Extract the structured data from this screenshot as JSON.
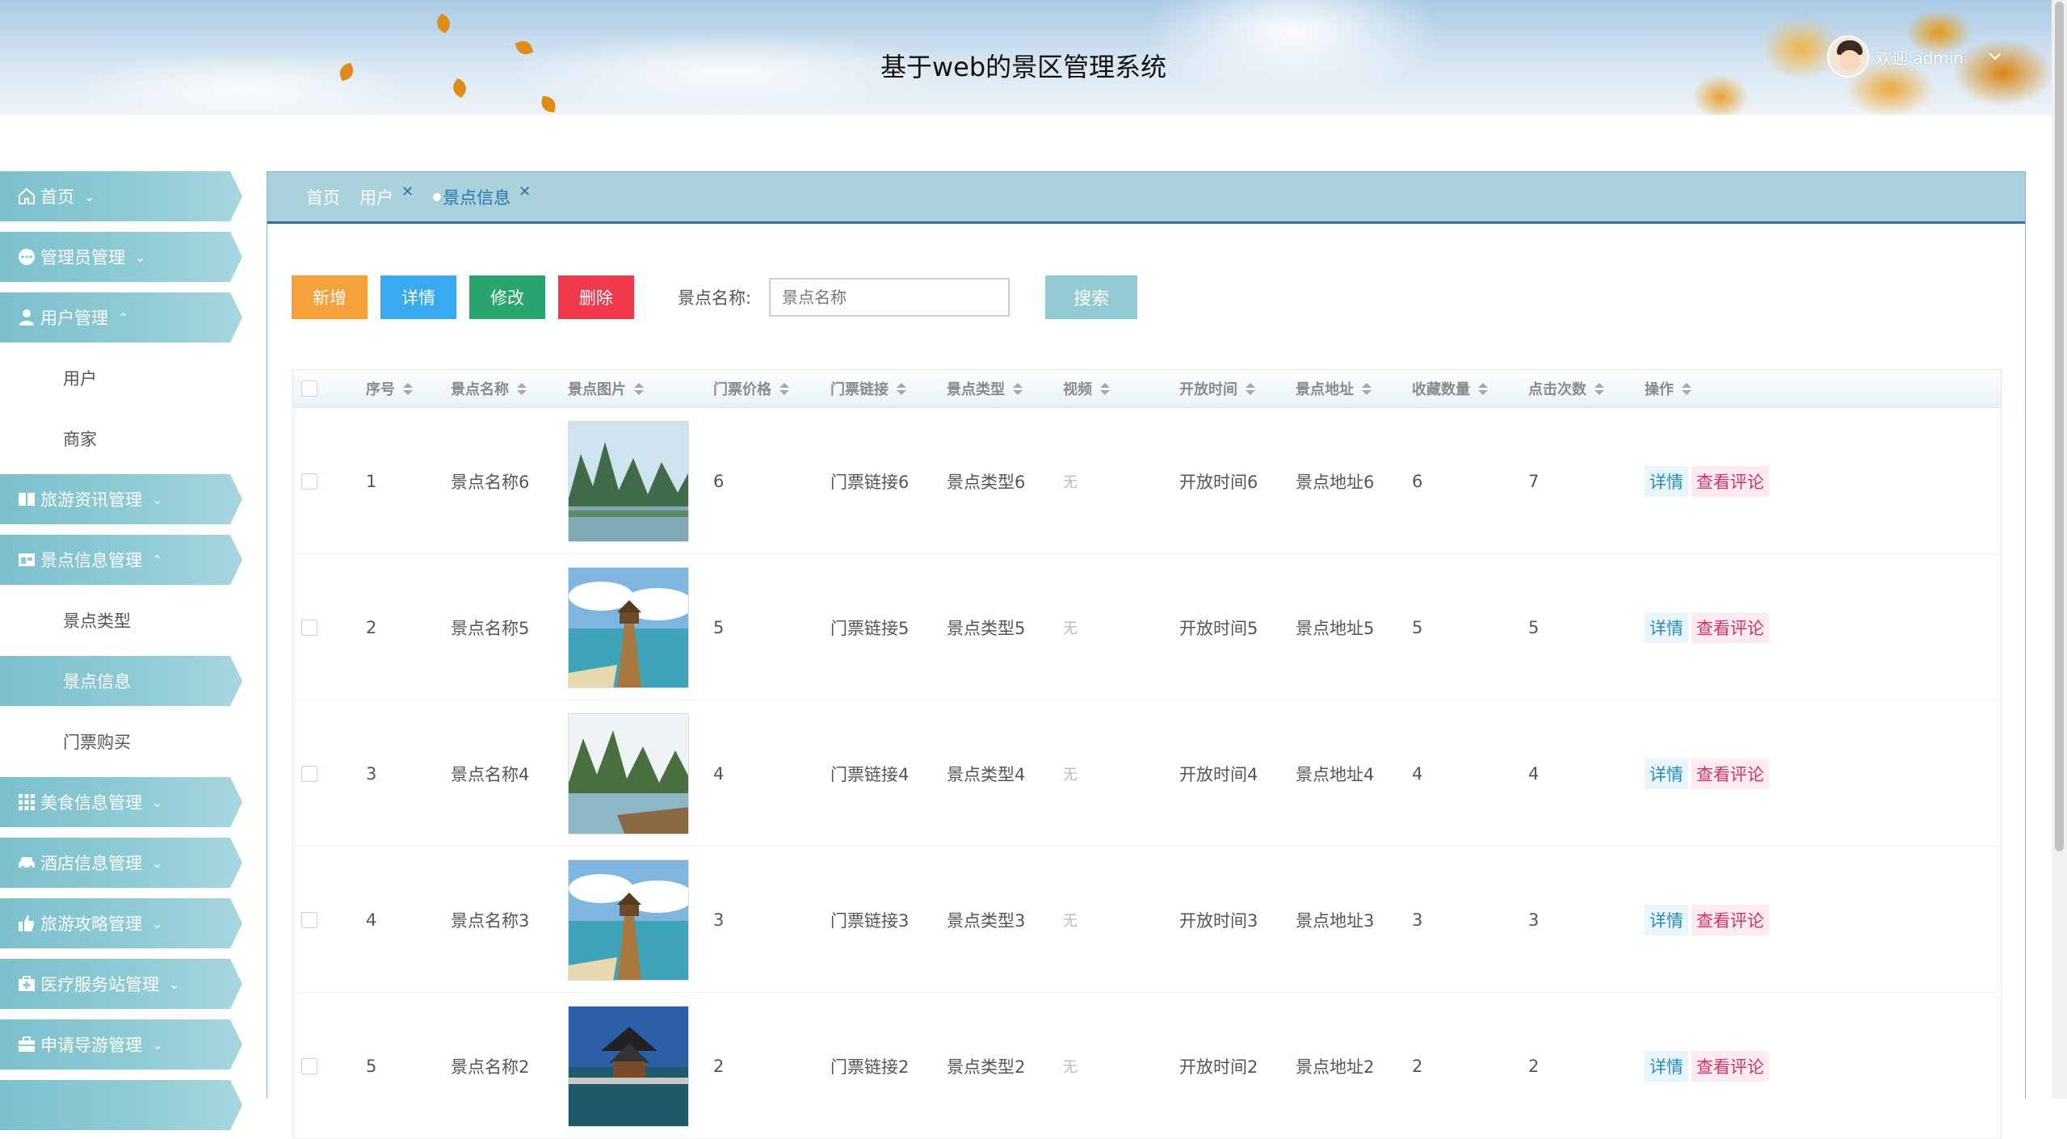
{
  "header": {
    "title": "基于web的景区管理系统",
    "welcome": "欢迎 admin"
  },
  "sidebar": {
    "items": [
      {
        "label": "首页",
        "icon": "home-icon",
        "caret": "chevron-down"
      },
      {
        "label": "管理员管理",
        "icon": "chat-icon",
        "caret": "chevron-down"
      },
      {
        "label": "用户管理",
        "icon": "user-icon",
        "caret": "chevron-up"
      },
      {
        "label": "用户",
        "sub": true
      },
      {
        "label": "商家",
        "sub": true
      },
      {
        "label": "旅游资讯管理",
        "icon": "book-icon",
        "caret": "chevron-down"
      },
      {
        "label": "景点信息管理",
        "icon": "store-icon",
        "caret": "chevron-up"
      },
      {
        "label": "景点类型",
        "sub": true
      },
      {
        "label": "景点信息",
        "sub": true,
        "active": true
      },
      {
        "label": "门票购买",
        "sub": true
      },
      {
        "label": "美食信息管理",
        "icon": "grid-icon",
        "caret": "chevron-down"
      },
      {
        "label": "酒店信息管理",
        "icon": "car-icon",
        "caret": "chevron-down"
      },
      {
        "label": "旅游攻略管理",
        "icon": "thumb-icon",
        "caret": "chevron-down"
      },
      {
        "label": "医疗服务站管理",
        "icon": "medkit-icon",
        "caret": "chevron-down"
      },
      {
        "label": "申请导游管理",
        "icon": "briefcase-icon",
        "caret": "chevron-down"
      }
    ]
  },
  "tabs": [
    {
      "label": "首页",
      "closable": false
    },
    {
      "label": "用户",
      "closable": true
    },
    {
      "label": "景点信息",
      "closable": true,
      "active": true
    }
  ],
  "toolbar": {
    "add": "新增",
    "detail": "详情",
    "edit": "修改",
    "delete": "删除",
    "search_label": "景点名称:",
    "search_placeholder": "景点名称",
    "search_button": "搜索"
  },
  "table": {
    "columns": [
      "序号",
      "景点名称",
      "景点图片",
      "门票价格",
      "门票链接",
      "景点类型",
      "视频",
      "开放时间",
      "景点地址",
      "收藏数量",
      "点击次数",
      "操作"
    ],
    "rows": [
      {
        "index": "1",
        "name": "景点名称6",
        "image": "karst-river",
        "price": "6",
        "link": "门票链接6",
        "type": "景点类型6",
        "video": "无",
        "open": "开放时间6",
        "address": "景点地址6",
        "favorites": "6",
        "clicks": "7"
      },
      {
        "index": "2",
        "name": "景点名称5",
        "image": "pier-pavilion",
        "price": "5",
        "link": "门票链接5",
        "type": "景点类型5",
        "video": "无",
        "open": "开放时间5",
        "address": "景点地址5",
        "favorites": "5",
        "clicks": "5"
      },
      {
        "index": "3",
        "name": "景点名称4",
        "image": "karst-boat",
        "price": "4",
        "link": "门票链接4",
        "type": "景点类型4",
        "video": "无",
        "open": "开放时间4",
        "address": "景点地址4",
        "favorites": "4",
        "clicks": "4"
      },
      {
        "index": "4",
        "name": "景点名称3",
        "image": "pier-pavilion",
        "price": "3",
        "link": "门票链接3",
        "type": "景点类型3",
        "video": "无",
        "open": "开放时间3",
        "address": "景点地址3",
        "favorites": "3",
        "clicks": "3"
      },
      {
        "index": "5",
        "name": "景点名称2",
        "image": "pagoda-lake",
        "price": "2",
        "link": "门票链接2",
        "type": "景点类型2",
        "video": "无",
        "open": "开放时间2",
        "address": "景点地址2",
        "favorites": "2",
        "clicks": "2"
      }
    ],
    "op_detail": "详情",
    "op_comments": "查看评论"
  },
  "colors": {
    "accent": "#2b73a7",
    "menu": "#8ecbd5",
    "add": "#f6a13a",
    "detail": "#3aaaf0",
    "edit": "#2aa56f",
    "delete": "#ef3a4c"
  }
}
